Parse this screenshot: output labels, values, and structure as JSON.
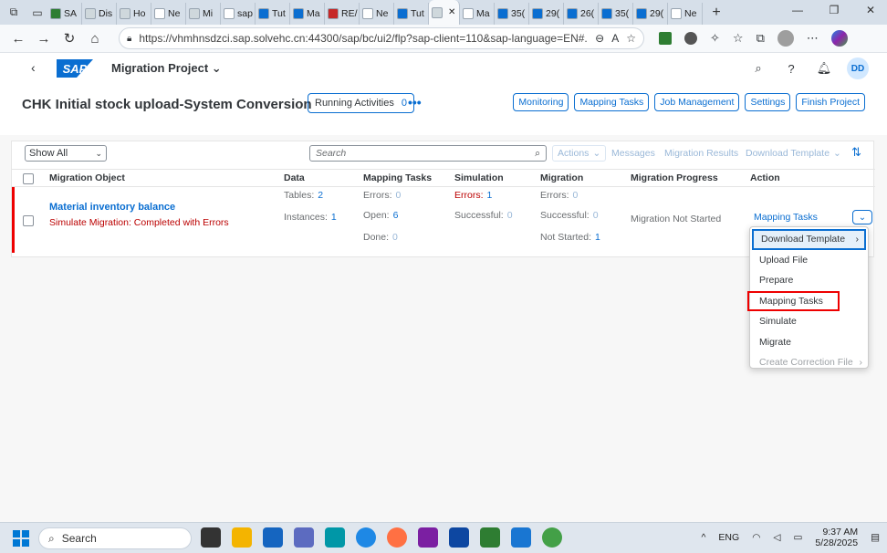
{
  "browser": {
    "tabs": [
      {
        "label": "SA",
        "color": "#2e7d32"
      },
      {
        "label": "Dis",
        "color": "#cfd8dc"
      },
      {
        "label": "Ho",
        "color": "#cfd8dc"
      },
      {
        "label": "Ne",
        "color": "#ffffff"
      },
      {
        "label": "Mi",
        "color": "#cfd8dc"
      },
      {
        "label": "sap",
        "color": "#ffffff"
      },
      {
        "label": "Tut",
        "color": "#0a6ed1"
      },
      {
        "label": "Ma",
        "color": "#0a6ed1"
      },
      {
        "label": "RE/",
        "color": "#c62828"
      },
      {
        "label": "Ne",
        "color": "#ffffff"
      },
      {
        "label": "Tut",
        "color": "#0a6ed1"
      },
      {
        "label": "",
        "color": "#cfd8dc",
        "active": true
      },
      {
        "label": "Ma",
        "color": "#ffffff"
      },
      {
        "label": "35(",
        "color": "#0a6ed1"
      },
      {
        "label": "29(",
        "color": "#0a6ed1"
      },
      {
        "label": "26(",
        "color": "#0a6ed1"
      },
      {
        "label": "35(",
        "color": "#0a6ed1"
      },
      {
        "label": "29(",
        "color": "#0a6ed1"
      },
      {
        "label": "Ne",
        "color": "#ffffff"
      }
    ],
    "url": "https://vhmhnsdzci.sap.solvehc.cn:44300/sap/bc/ui2/flp?sap-client=110&sap-language=EN#..."
  },
  "shell": {
    "logo": "SAP",
    "title": "Migration Project ⌄",
    "avatar": "DD"
  },
  "header": {
    "title": "CHK Initial stock upload-System Conversion",
    "running_label": "Running Activities",
    "running_count": "0",
    "buttons": [
      "Monitoring",
      "Mapping Tasks",
      "Job Management",
      "Settings",
      "Finish Project"
    ]
  },
  "toolbar": {
    "filter": "Show All",
    "search_placeholder": "Search",
    "actions": "Actions",
    "messages": "Messages",
    "migration_results": "Migration Results",
    "download_template": "Download Template"
  },
  "columns": {
    "object": "Migration Object",
    "data": "Data",
    "mapping": "Mapping Tasks",
    "simulation": "Simulation",
    "migration": "Migration",
    "progress": "Migration Progress",
    "action": "Action"
  },
  "row": {
    "object": "Material inventory balance",
    "status": "Simulate Migration: Completed with Errors",
    "tables_label": "Tables:",
    "tables": "2",
    "instances_label": "Instances:",
    "instances": "1",
    "map_errors_label": "Errors:",
    "map_errors": "0",
    "map_open_label": "Open:",
    "map_open": "6",
    "map_done_label": "Done:",
    "map_done": "0",
    "sim_errors_label": "Errors:",
    "sim_errors": "1",
    "sim_success_label": "Successful:",
    "sim_success": "0",
    "mig_errors_label": "Errors:",
    "mig_errors": "0",
    "mig_success_label": "Successful:",
    "mig_success": "0",
    "mig_notstarted_label": "Not Started:",
    "mig_notstarted": "1",
    "progress": "Migration Not Started",
    "action": "Mapping Tasks"
  },
  "menu": {
    "items": [
      "Download Template",
      "Upload File",
      "Prepare",
      "Mapping Tasks",
      "Simulate",
      "Migrate",
      "Create Correction File"
    ]
  },
  "taskbar": {
    "search": "Search",
    "lang": "ENG",
    "time": "9:37 AM",
    "date": "5/28/2025"
  }
}
